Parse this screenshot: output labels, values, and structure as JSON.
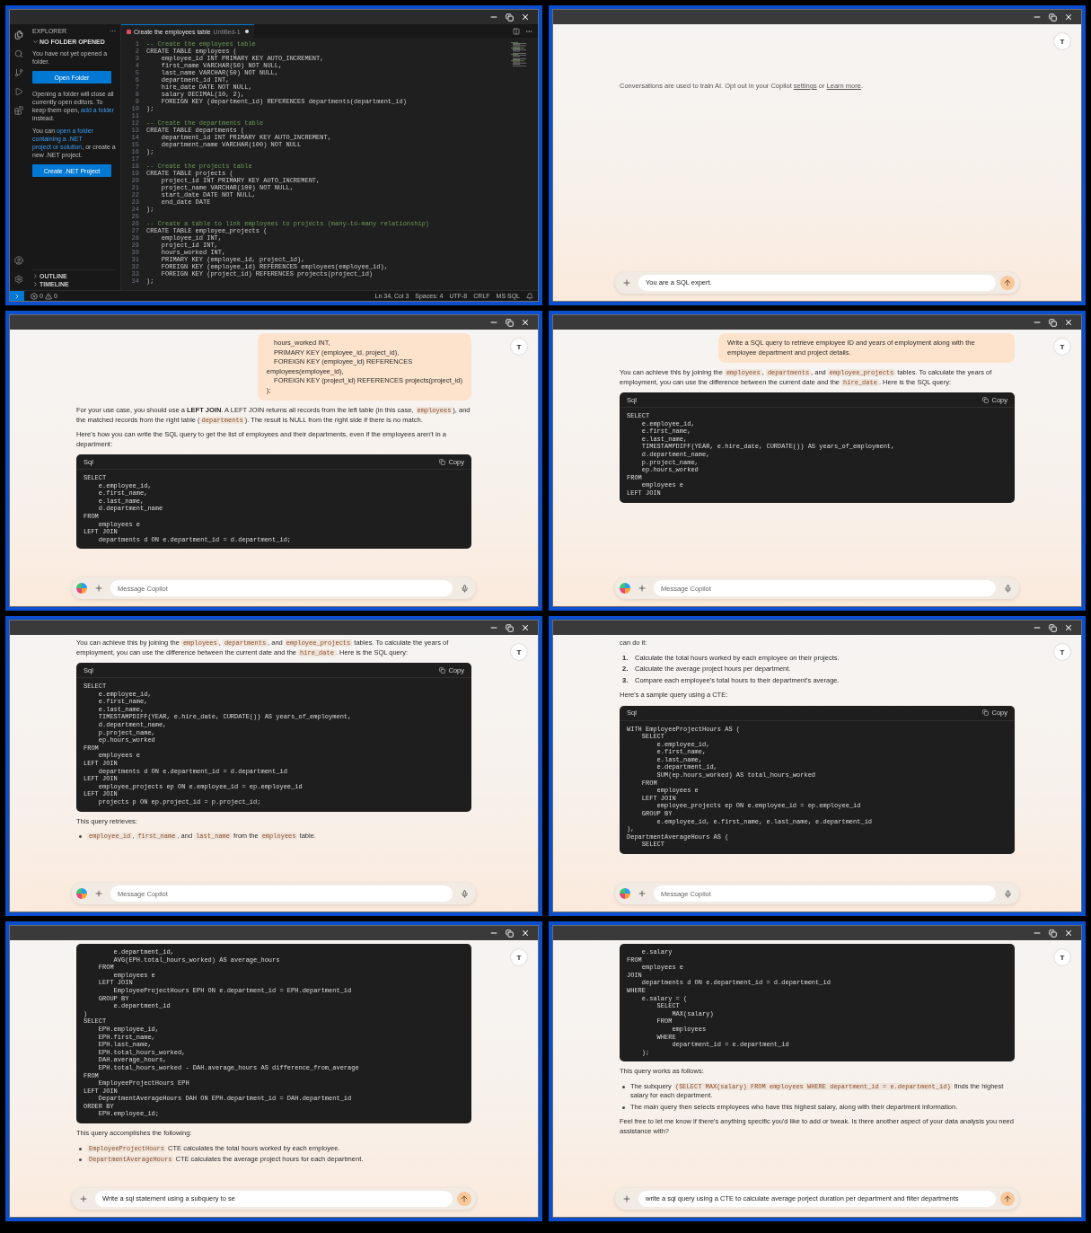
{
  "panels": [
    {
      "kind": "vscode",
      "explorer": {
        "title": "EXPLORER",
        "more": "···",
        "section": "NO FOLDER OPENED",
        "intro": "You have not yet opened a folder.",
        "open_button": "Open Folder",
        "paragraphs": [
          [
            {
              "kind": "text",
              "text": "Opening a folder will close all currently open editors. To keep them open, "
            },
            {
              "kind": "link",
              "text": "add a folder"
            },
            {
              "kind": "text",
              "text": " instead."
            }
          ],
          [
            {
              "kind": "text",
              "text": "You can "
            },
            {
              "kind": "link",
              "text": "open a folder"
            },
            {
              "kind": "link",
              "text": "containing a .NET"
            },
            {
              "kind": "link",
              "text": "project or solution"
            },
            {
              "kind": "text",
              "text": ", or create a new .NET project."
            }
          ]
        ],
        "create_button": "Create .NET Project",
        "bottom_sections": [
          "OUTLINE",
          "TIMELINE"
        ]
      },
      "tab": {
        "title": "Create the employees table",
        "subtitle": "Untitled-1",
        "modified": true
      },
      "lines": [
        {
          "n": "1",
          "kind": "comment",
          "text": "-- Create the employees table"
        },
        {
          "n": "2",
          "kind": "code",
          "text": "CREATE TABLE employees ("
        },
        {
          "n": "3",
          "kind": "code",
          "text": "    employee_id INT PRIMARY KEY AUTO_INCREMENT,"
        },
        {
          "n": "4",
          "kind": "code",
          "text": "    first_name VARCHAR(50) NOT NULL,"
        },
        {
          "n": "5",
          "kind": "code",
          "text": "    last_name VARCHAR(50) NOT NULL,"
        },
        {
          "n": "6",
          "kind": "code",
          "text": "    department_id INT,"
        },
        {
          "n": "7",
          "kind": "code",
          "text": "    hire_date DATE NOT NULL,"
        },
        {
          "n": "8",
          "kind": "code",
          "text": "    salary DECIMAL(10, 2),"
        },
        {
          "n": "9",
          "kind": "code",
          "text": "    FOREIGN KEY (department_id) REFERENCES departments(department_id)"
        },
        {
          "n": "10",
          "kind": "code",
          "text": ");"
        },
        {
          "n": "11",
          "kind": "code"
        },
        {
          "n": "12",
          "kind": "comment",
          "text": "-- Create the departments table"
        },
        {
          "n": "13",
          "kind": "code",
          "text": "CREATE TABLE departments ("
        },
        {
          "n": "14",
          "kind": "code",
          "text": "    department_id INT PRIMARY KEY AUTO_INCREMENT,"
        },
        {
          "n": "15",
          "kind": "code",
          "text": "    department_name VARCHAR(100) NOT NULL"
        },
        {
          "n": "16",
          "kind": "code",
          "text": ");"
        },
        {
          "n": "17",
          "kind": "code"
        },
        {
          "n": "18",
          "kind": "comment",
          "text": "-- Create the projects table"
        },
        {
          "n": "19",
          "kind": "code",
          "text": "CREATE TABLE projects ("
        },
        {
          "n": "20",
          "kind": "code",
          "text": "    project_id INT PRIMARY KEY AUTO_INCREMENT,"
        },
        {
          "n": "21",
          "kind": "code",
          "text": "    project_name VARCHAR(100) NOT NULL,"
        },
        {
          "n": "22",
          "kind": "code",
          "text": "    start_date DATE NOT NULL,"
        },
        {
          "n": "23",
          "kind": "code",
          "text": "    end_date DATE"
        },
        {
          "n": "24",
          "kind": "code",
          "text": ");"
        },
        {
          "n": "25",
          "kind": "code"
        },
        {
          "n": "26",
          "kind": "comment",
          "text": "-- Create a table to link employees to projects (many-to-many relationship)"
        },
        {
          "n": "27",
          "kind": "code",
          "text": "CREATE TABLE employee_projects ("
        },
        {
          "n": "28",
          "kind": "code",
          "text": "    employee_id INT,"
        },
        {
          "n": "29",
          "kind": "code",
          "text": "    project_id INT,"
        },
        {
          "n": "30",
          "kind": "code",
          "text": "    hours_worked INT,"
        },
        {
          "n": "31",
          "kind": "code",
          "text": "    PRIMARY KEY (employee_id, project_id),"
        },
        {
          "n": "32",
          "kind": "code",
          "text": "    FOREIGN KEY (employee_id) REFERENCES employees(employee_id),"
        },
        {
          "n": "33",
          "kind": "code",
          "text": "    FOREIGN KEY (project_id) REFERENCES projects(project_id)"
        },
        {
          "n": "34",
          "kind": "code",
          "text": ");"
        }
      ],
      "status_bar": {
        "errors": "0",
        "warnings": "0",
        "items": [
          "Ln 34, Col 3",
          "Spaces: 4",
          "UTF-8",
          "CRLF",
          "MS SQL"
        ]
      }
    },
    {
      "kind": "chat",
      "avatar": "T",
      "blocks": [
        {
          "kind": "notice",
          "segments": [
            {
              "kind": "text",
              "text": "Conversations are used to train AI. Opt out in your Copilot "
            },
            {
              "kind": "link",
              "text": "settings"
            },
            {
              "kind": "text",
              "text": " or "
            },
            {
              "kind": "link",
              "text": "Learn more"
            },
            {
              "kind": "text",
              "text": "."
            }
          ]
        }
      ],
      "composer": {
        "value": "You are a SQL expert."
      }
    },
    {
      "kind": "chat",
      "avatar": "T",
      "blocks": [
        {
          "kind": "user",
          "text": "    hours_worked INT,\n    PRIMARY KEY (employee_id, project_id),\n    FOREIGN KEY (employee_id) REFERENCES\nemployees(employee_id),\n    FOREIGN KEY (project_id) REFERENCES projects(project_id)\n);"
        },
        {
          "kind": "paragraph",
          "segments": [
            {
              "kind": "text",
              "text": "For your use case, you should use a "
            },
            {
              "kind": "bold",
              "text": "LEFT JOIN"
            },
            {
              "kind": "text",
              "text": ". A LEFT JOIN returns all records from the left table (in this case, "
            },
            {
              "kind": "code",
              "text": "employees"
            },
            {
              "kind": "text",
              "text": "), and the matched records from the right table ("
            },
            {
              "kind": "code",
              "text": "departments"
            },
            {
              "kind": "text",
              "text": "). The result is NULL from the right side if there is no match."
            }
          ]
        },
        {
          "kind": "paragraph",
          "segments": [
            {
              "kind": "text",
              "text": "Here's how you can write the SQL query to get the list of employees and their departments, even if the employees aren't in a department:"
            }
          ]
        },
        {
          "kind": "code",
          "label": "Sql",
          "copy": "Copy",
          "lines": [
            "SELECT",
            "    e.employee_id,",
            "    e.first_name,",
            "    e.last_name,",
            "    d.department_name",
            "FROM",
            "    employees e",
            "LEFT JOIN",
            "    departments d ON e.department_id = d.department_id;"
          ]
        }
      ],
      "composer": {
        "placeholder": "Message Copilot"
      }
    },
    {
      "kind": "chat",
      "avatar": "T",
      "blocks": [
        {
          "kind": "user",
          "text": "Write a SQL query to retrieve employee ID and years of employment along with the employee department and project details."
        },
        {
          "kind": "paragraph",
          "segments": [
            {
              "kind": "text",
              "text": "You can achieve this by joining the "
            },
            {
              "kind": "code",
              "text": "employees"
            },
            {
              "kind": "text",
              "text": ", "
            },
            {
              "kind": "code",
              "text": "departments"
            },
            {
              "kind": "text",
              "text": ", and "
            },
            {
              "kind": "code",
              "text": "employee_projects"
            },
            {
              "kind": "text",
              "text": " tables. To calculate the years of employment, you can use the difference between the current date and the "
            },
            {
              "kind": "code",
              "text": "hire_date"
            },
            {
              "kind": "text",
              "text": ". Here is the SQL query:"
            }
          ]
        },
        {
          "kind": "code",
          "label": "Sql",
          "copy": "Copy",
          "lines": [
            "SELECT",
            "    e.employee_id,",
            "    e.first_name,",
            "    e.last_name,",
            "    TIMESTAMPDIFF(YEAR, e.hire_date, CURDATE()) AS years_of_employment,",
            "    d.department_name,",
            "    p.project_name,",
            "    ep.hours_worked",
            "FROM",
            "    employees e",
            "LEFT JOIN"
          ]
        }
      ],
      "composer": {
        "placeholder": "Message Copilot"
      }
    },
    {
      "kind": "chat",
      "avatar": "T",
      "blocks": [
        {
          "kind": "paragraph",
          "segments": [
            {
              "kind": "text",
              "text": "You can achieve this by joining the "
            },
            {
              "kind": "code",
              "text": "employees"
            },
            {
              "kind": "text",
              "text": ", "
            },
            {
              "kind": "code",
              "text": "departments"
            },
            {
              "kind": "text",
              "text": ", and "
            },
            {
              "kind": "code",
              "text": "employee_projects"
            },
            {
              "kind": "text",
              "text": " tables. To calculate the years of employment, you can use the difference between the current date and the "
            },
            {
              "kind": "code",
              "text": "hire_date"
            },
            {
              "kind": "text",
              "text": ". Here is the SQL query:"
            }
          ]
        },
        {
          "kind": "code",
          "label": "Sql",
          "copy": "Copy",
          "lines": [
            "SELECT",
            "    e.employee_id,",
            "    e.first_name,",
            "    e.last_name,",
            "    TIMESTAMPDIFF(YEAR, e.hire_date, CURDATE()) AS years_of_employment,",
            "    d.department_name,",
            "    p.project_name,",
            "    ep.hours_worked",
            "FROM",
            "    employees e",
            "LEFT JOIN",
            "    departments d ON e.department_id = d.department_id",
            "LEFT JOIN",
            "    employee_projects ep ON e.employee_id = ep.employee_id",
            "LEFT JOIN",
            "    projects p ON ep.project_id = p.project_id;"
          ]
        },
        {
          "kind": "paragraph",
          "segments": [
            {
              "kind": "text",
              "text": "This query retrieves:"
            }
          ]
        },
        {
          "kind": "bullets",
          "items": [
            {
              "segments": [
                {
                  "kind": "code",
                  "text": "employee_id"
                },
                {
                  "kind": "text",
                  "text": ", "
                },
                {
                  "kind": "code",
                  "text": "first_name"
                },
                {
                  "kind": "text",
                  "text": ", and "
                },
                {
                  "kind": "code",
                  "text": "last_name"
                },
                {
                  "kind": "text",
                  "text": " from the "
                },
                {
                  "kind": "code",
                  "text": "employees"
                },
                {
                  "kind": "text",
                  "text": " table."
                }
              ]
            }
          ]
        }
      ],
      "composer": {
        "placeholder": "Message Copilot"
      }
    },
    {
      "kind": "chat",
      "avatar": "T",
      "blocks": [
        {
          "kind": "paragraph",
          "segments": [
            {
              "kind": "text",
              "text": "can do it:"
            }
          ]
        },
        {
          "kind": "ordered",
          "items": [
            {
              "number": "1.",
              "segments": [
                {
                  "kind": "text",
                  "text": "Calculate the total hours worked by each employee on their projects."
                }
              ]
            },
            {
              "number": "2.",
              "segments": [
                {
                  "kind": "text",
                  "text": "Calculate the average project hours per department."
                }
              ]
            },
            {
              "number": "3.",
              "segments": [
                {
                  "kind": "text",
                  "text": "Compare each employee's total hours to their department's average."
                }
              ]
            }
          ]
        },
        {
          "kind": "paragraph",
          "segments": [
            {
              "kind": "text",
              "text": "Here's a sample query using a CTE:"
            }
          ]
        },
        {
          "kind": "code",
          "label": "Sql",
          "copy": "Copy",
          "lines": [
            "WITH EmployeeProjectHours AS (",
            "    SELECT",
            "        e.employee_id,",
            "        e.first_name,",
            "        e.last_name,",
            "        e.department_id,",
            "        SUM(ep.hours_worked) AS total_hours_worked",
            "    FROM",
            "        employees e",
            "    LEFT JOIN",
            "        employee_projects ep ON e.employee_id = ep.employee_id",
            "    GROUP BY",
            "        e.employee_id, e.first_name, e.last_name, e.department_id",
            "),",
            "DepartmentAverageHours AS (",
            "    SELECT"
          ]
        }
      ],
      "composer": {
        "placeholder": "Message Copilot"
      }
    },
    {
      "kind": "chat",
      "avatar": "T",
      "blocks": [
        {
          "kind": "code",
          "lines": [
            "        e.department_id,",
            "        AVG(EPH.total_hours_worked) AS average_hours",
            "    FROM",
            "        employees e",
            "    LEFT JOIN",
            "        EmployeeProjectHours EPH ON e.department_id = EPH.department_id",
            "    GROUP BY",
            "        e.department_id",
            ")",
            "SELECT",
            "    EPH.employee_id,",
            "    EPH.first_name,",
            "    EPH.last_name,",
            "    EPH.total_hours_worked,",
            "    DAH.average_hours,",
            "    EPH.total_hours_worked - DAH.average_hours AS difference_from_average",
            "FROM",
            "    EmployeeProjectHours EPH",
            "LEFT JOIN",
            "    DepartmentAverageHours DAH ON EPH.department_id = DAH.department_id",
            "ORDER BY",
            "    EPH.employee_id;"
          ]
        },
        {
          "kind": "paragraph",
          "segments": [
            {
              "kind": "text",
              "text": "This query accomplishes the following:"
            }
          ]
        },
        {
          "kind": "bullets",
          "items": [
            {
              "segments": [
                {
                  "kind": "code",
                  "text": "EmployeeProjectHours"
                },
                {
                  "kind": "text",
                  "text": " CTE calculates the total hours worked by each employee."
                }
              ]
            },
            {
              "segments": [
                {
                  "kind": "code",
                  "text": "DepartmentAverageHours"
                },
                {
                  "kind": "text",
                  "text": " CTE calculates the average project hours for each department."
                }
              ]
            }
          ]
        }
      ],
      "composer": {
        "value": "Write a sql statement using a subquery to se"
      }
    },
    {
      "kind": "chat",
      "avatar": "T",
      "blocks": [
        {
          "kind": "code",
          "lines": [
            "    e.salary",
            "FROM",
            "    employees e",
            "JOIN",
            "    departments d ON e.department_id = d.department_id",
            "WHERE",
            "    e.salary = (",
            "        SELECT",
            "            MAX(salary)",
            "        FROM",
            "            employees",
            "        WHERE",
            "            department_id = e.department_id",
            "    );"
          ]
        },
        {
          "kind": "paragraph",
          "segments": [
            {
              "kind": "text",
              "text": "This query works as follows:"
            }
          ]
        },
        {
          "kind": "bullets",
          "items": [
            {
              "segments": [
                {
                  "kind": "text",
                  "text": "The subquery "
                },
                {
                  "kind": "code",
                  "text": "(SELECT MAX(salary) FROM employees WHERE department_id = e.department_id)"
                },
                {
                  "kind": "text",
                  "text": " finds the highest salary for each department."
                }
              ]
            },
            {
              "segments": [
                {
                  "kind": "text",
                  "text": "The main query then selects employees who have this highest salary, along with their department information."
                }
              ]
            }
          ]
        },
        {
          "kind": "paragraph",
          "segments": [
            {
              "kind": "text",
              "text": "Feel free to let me know if there's anything specific you'd like to add or tweak. Is there another aspect of your data analysis you need assistance with?"
            }
          ]
        }
      ],
      "composer": {
        "value": "write a sql query using a CTE to calculate average porject duration per department and filter departments"
      }
    }
  ]
}
